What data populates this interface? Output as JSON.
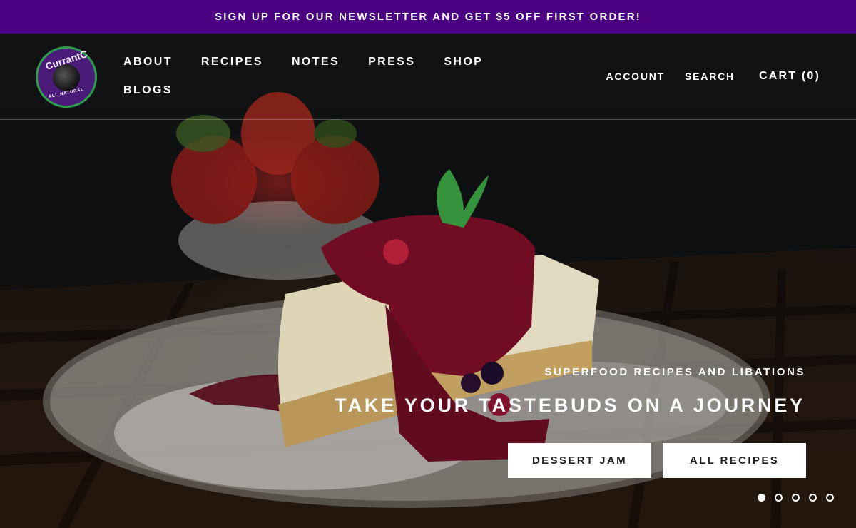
{
  "announcement": {
    "text": "SIGN UP FOR OUR NEWSLETTER AND GET $5 OFF FIRST ORDER!"
  },
  "logo": {
    "brand": "CurrantC",
    "tagline": "ALL NATURAL"
  },
  "nav": {
    "items": [
      {
        "label": "ABOUT"
      },
      {
        "label": "RECIPES"
      },
      {
        "label": "NOTES"
      },
      {
        "label": "PRESS"
      },
      {
        "label": "SHOP"
      },
      {
        "label": "BLOGS"
      }
    ]
  },
  "utility": {
    "account": "ACCOUNT",
    "search": "SEARCH",
    "cart": "CART (0)"
  },
  "hero": {
    "kicker": "SUPERFOOD RECIPES AND LIBATIONS",
    "headline": "TAKE YOUR TASTEBUDS ON A JOURNEY",
    "buttons": [
      {
        "label": "DESSERT JAM"
      },
      {
        "label": "ALL RECIPES"
      }
    ],
    "slides": {
      "count": 5,
      "active": 1
    }
  },
  "colors": {
    "announcement_bg": "#4b0082",
    "logo_bg": "#4b1b7a",
    "logo_ring": "#2e9e4e",
    "button_bg": "#ffffff",
    "button_text": "#1d1d1d"
  }
}
